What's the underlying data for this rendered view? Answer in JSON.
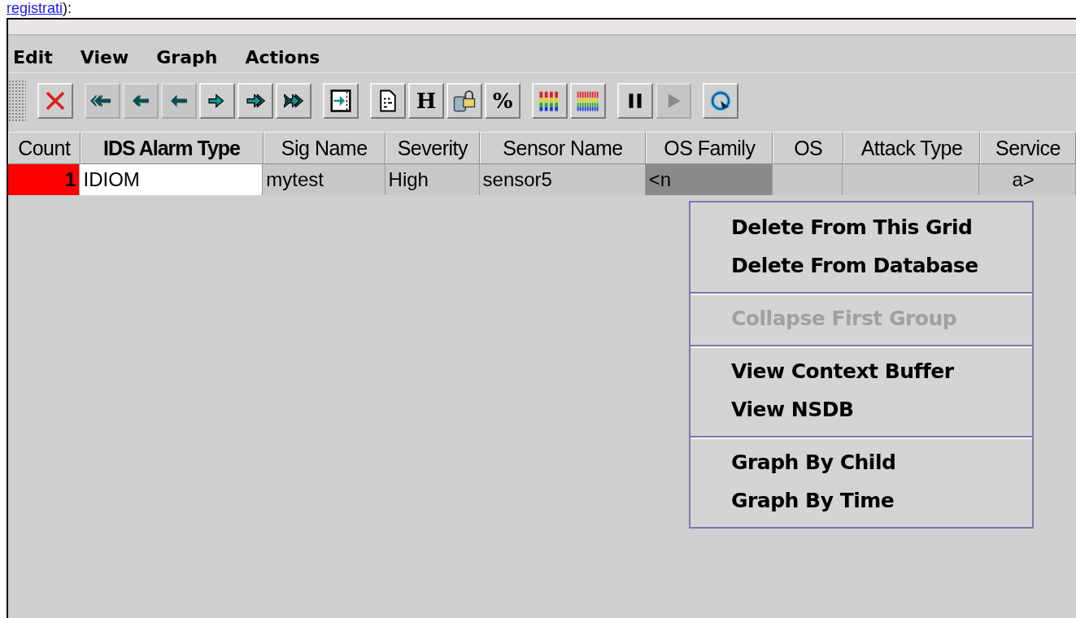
{
  "page_link": {
    "link": "registrati",
    "after": "):"
  },
  "menu_bar": [
    {
      "label": "Edit"
    },
    {
      "label": "View"
    },
    {
      "label": "Graph"
    },
    {
      "label": "Actions"
    }
  ],
  "toolbar": [
    [
      {
        "kind": "delete",
        "disabled": false
      }
    ],
    [
      {
        "kind": "first",
        "disabled": true
      },
      {
        "kind": "prev-page",
        "disabled": true
      },
      {
        "kind": "prev",
        "disabled": true
      },
      {
        "kind": "next",
        "disabled": false
      },
      {
        "kind": "next-page",
        "disabled": false
      },
      {
        "kind": "last",
        "disabled": false
      }
    ],
    [
      {
        "kind": "export",
        "disabled": false
      }
    ],
    [
      {
        "kind": "document",
        "disabled": false
      },
      {
        "kind": "text",
        "label": "H",
        "disabled": false
      },
      {
        "kind": "lock",
        "disabled": false
      },
      {
        "kind": "text",
        "label": "%",
        "disabled": false
      }
    ],
    [
      {
        "kind": "bars",
        "disabled": false
      },
      {
        "kind": "bars-many",
        "disabled": false
      }
    ],
    [
      {
        "kind": "pause",
        "disabled": false
      },
      {
        "kind": "play",
        "disabled": true
      }
    ],
    [
      {
        "kind": "refresh",
        "disabled": false
      }
    ]
  ],
  "table": {
    "columns": [
      {
        "label": "Count",
        "sorted": false
      },
      {
        "label": "IDS Alarm Type",
        "sorted": true
      },
      {
        "label": "Sig Name",
        "sorted": false
      },
      {
        "label": "Severity",
        "sorted": false
      },
      {
        "label": "Sensor Name",
        "sorted": false
      },
      {
        "label": "OS Family",
        "sorted": false
      },
      {
        "label": "OS",
        "sorted": false
      },
      {
        "label": "Attack Type",
        "sorted": false
      },
      {
        "label": "Service",
        "sorted": false
      }
    ],
    "rows": [
      {
        "cells": [
          {
            "kind": "count",
            "text": "1",
            "color": "#ff0000"
          },
          {
            "text": "IDIOM",
            "focused": true,
            "selected": false
          },
          {
            "text": "mytest",
            "focused": false,
            "selected": false
          },
          {
            "text": "High",
            "focused": false,
            "selected": false
          },
          {
            "text": "sensor5",
            "focused": false,
            "selected": false
          },
          {
            "text": "<n",
            "focused": false,
            "selected": true
          },
          {
            "text": "",
            "focused": false,
            "selected": false
          },
          {
            "text": "",
            "focused": false,
            "selected": false
          },
          {
            "text": "a>",
            "focused": false,
            "selected": false
          }
        ]
      }
    ]
  },
  "context_menu": [
    [
      {
        "label": "Delete From This Grid",
        "disabled": false
      },
      {
        "label": "Delete From Database",
        "disabled": false
      }
    ],
    [
      {
        "label": "Collapse First Group",
        "disabled": true
      }
    ],
    [
      {
        "label": "View Context Buffer",
        "disabled": false
      },
      {
        "label": "View NSDB",
        "disabled": false
      }
    ],
    [
      {
        "label": "Graph By Child",
        "disabled": false
      },
      {
        "label": "Graph By Time",
        "disabled": false
      }
    ]
  ]
}
